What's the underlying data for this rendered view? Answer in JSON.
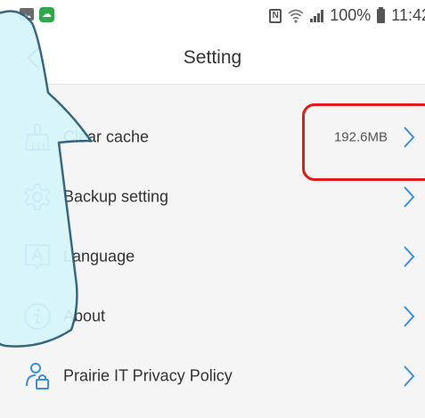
{
  "status_bar": {
    "battery": "100%",
    "time": "11:42"
  },
  "header": {
    "title": "Setting"
  },
  "items": [
    {
      "label": "Clear cache",
      "value": "192.6MB",
      "icon": "broom-icon"
    },
    {
      "label": "Backup setting",
      "icon": "gear-icon"
    },
    {
      "label": "Language",
      "icon": "language-icon"
    },
    {
      "label": "About",
      "icon": "info-icon"
    },
    {
      "label": "Prairie IT Privacy Policy",
      "icon": "privacy-lock-icon"
    }
  ],
  "colors": {
    "accent": "#3a8fe0",
    "highlight": "#e11b1b",
    "callout_fill": "#d6f5fb",
    "callout_stroke": "#2a5d78"
  }
}
